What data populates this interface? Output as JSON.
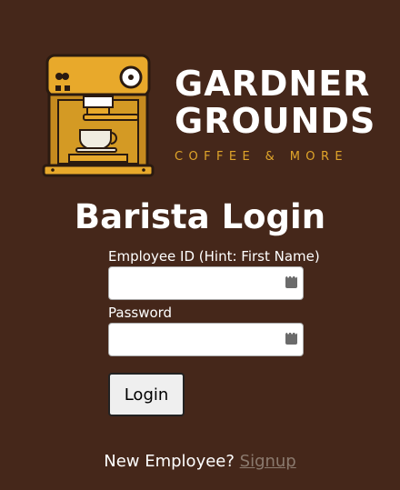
{
  "brand": {
    "line1": "GARDNER",
    "line2": "GROUNDS",
    "tagline": "COFFEE & MORE",
    "accent_color": "#e0a52a",
    "logo_icon": "espresso-machine-icon"
  },
  "page": {
    "title": "Barista Login",
    "background_color": "#45271a"
  },
  "form": {
    "employee_id_label": "Employee ID (Hint: First Name)",
    "employee_id_value": "",
    "password_label": "Password",
    "password_value": "",
    "field_icon": "password-manager-key-icon",
    "login_button": "Login"
  },
  "footer": {
    "prompt": "New Employee? ",
    "signup_link": "Signup"
  }
}
